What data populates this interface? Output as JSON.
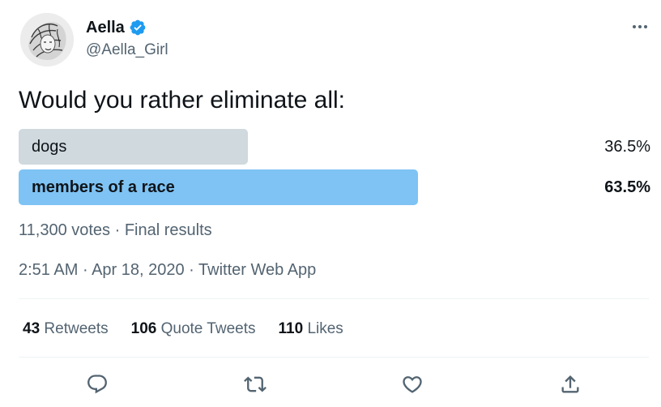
{
  "author": {
    "display_name": "Aella",
    "handle": "@Aella_Girl",
    "verified": true,
    "verified_color": "#1d9bf0"
  },
  "tweet": {
    "text": "Would you rather eliminate all:"
  },
  "poll": {
    "options": [
      {
        "label": "dogs",
        "percent_text": "36.5%",
        "percent": 36.5,
        "color": "#cfd9de",
        "winner": false
      },
      {
        "label": "members of a race",
        "percent_text": "63.5%",
        "percent": 63.5,
        "color": "#7ec3f4",
        "winner": true
      }
    ],
    "votes_text": "11,300 votes",
    "separator": "·",
    "status": "Final results"
  },
  "meta": {
    "time": "2:51 AM",
    "date": "Apr 18, 2020",
    "source": "Twitter Web App",
    "separator": "·"
  },
  "stats": {
    "retweets_count": "43",
    "retweets_label": "Retweets",
    "quotes_count": "106",
    "quotes_label": "Quote Tweets",
    "likes_count": "110",
    "likes_label": "Likes"
  },
  "actions": [
    {
      "icon": "reply-icon"
    },
    {
      "icon": "retweet-icon"
    },
    {
      "icon": "like-icon"
    },
    {
      "icon": "share-icon"
    }
  ],
  "colors": {
    "text_primary": "#0f1419",
    "text_secondary": "#536471",
    "divider": "#eff3f4"
  }
}
